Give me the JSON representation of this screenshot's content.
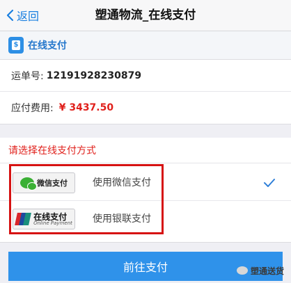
{
  "nav": {
    "back_label": "返回",
    "title": "塑通物流_在线支付"
  },
  "section": {
    "title": "在线支付",
    "icon": "wallet-icon"
  },
  "order": {
    "waybill_label": "运单号:",
    "waybill_number": "12191928230879",
    "fee_label": "应付费用:",
    "fee_value": "¥ 3437.50"
  },
  "methods": {
    "prompt": "请选择在线支付方式",
    "items": [
      {
        "badge_text": "微信支付",
        "label": "使用微信支付",
        "selected": true,
        "icon": "wechat-logo-icon"
      },
      {
        "badge_text": "在线支付",
        "badge_sub": "Online Payment",
        "label": "使用银联支付",
        "selected": false,
        "icon": "unionpay-logo-icon"
      }
    ]
  },
  "pay_button": {
    "label": "前往支付"
  },
  "watermark": {
    "text": "塑通送货"
  },
  "colors": {
    "accent": "#2f92ea",
    "highlight": "#d61212",
    "fee": "#e0201b"
  }
}
